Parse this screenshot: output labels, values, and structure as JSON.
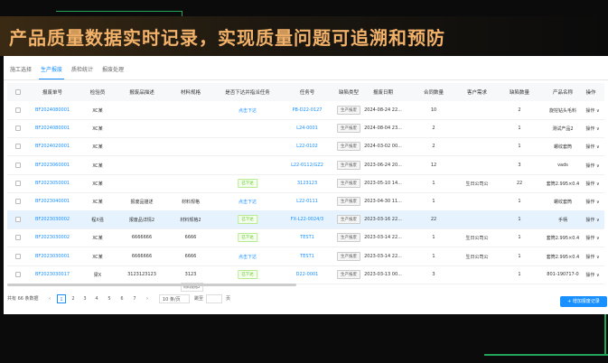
{
  "headline": "产品质量数据实时记录，实现质量问题可追溯和预防",
  "tabs": [
    "施工选择",
    "生产报废",
    "质检统计",
    "报废处理"
  ],
  "columns": [
    "",
    "报废单号",
    "检验员",
    "报废品描述",
    "材料规格",
    "是否下达并指派任务",
    "任务号",
    "缺陷类型",
    "报废日期",
    "合同数量",
    "客户需求",
    "缺陷数量",
    "产品名称",
    "操作"
  ],
  "rows": [
    {
      "no": "BF2024080001",
      "inspector": "XC某",
      "desc": "",
      "spec": "",
      "task_status": "点击下达",
      "task_no": "PB-D22-0127",
      "defect": "生产报废",
      "date": "2024-08-24 22...",
      "contract_qty": "10",
      "customer": "",
      "defect_qty": "2",
      "product": "旋挖钻头毛料",
      "action": "操作"
    },
    {
      "no": "BF2024080001",
      "inspector": "XC某",
      "desc": "",
      "spec": "",
      "task_status": "",
      "task_no": "L24-0001",
      "defect": "生产报废",
      "date": "2024-08-04 23...",
      "contract_qty": "2",
      "customer": "",
      "defect_qty": "1",
      "product": "测试产品2",
      "action": "操作"
    },
    {
      "no": "BF2024020001",
      "inspector": "XC某",
      "desc": "",
      "spec": "",
      "task_status": "",
      "task_no": "L22-0102",
      "defect": "生产报废",
      "date": "2024-03-02 00...",
      "contract_qty": "2",
      "customer": "",
      "defect_qty": "1",
      "product": "螺纹套筒",
      "action": "操作"
    },
    {
      "no": "BF2023060001",
      "inspector": "XC某",
      "desc": "",
      "spec": "",
      "task_status": "",
      "task_no": "L22-0112/GZ2",
      "defect": "生产报废",
      "date": "2023-06-24 20...",
      "contract_qty": "12",
      "customer": "",
      "defect_qty": "3",
      "product": "vads",
      "action": "操作"
    },
    {
      "no": "BF2023050001",
      "inspector": "XC某",
      "desc": "",
      "spec": "",
      "task_status": "已下达",
      "task_no": "3123123",
      "defect": "生产报废",
      "date": "2023-05-10 14...",
      "contract_qty": "1",
      "customer": "生日公司公",
      "defect_qty": "22",
      "product": "套筒2.995×0.4",
      "action": "操作"
    },
    {
      "no": "BF2023040001",
      "inspector": "XC某",
      "desc": "报废品描述",
      "spec": "材料规格",
      "task_status": "点击下达",
      "task_no": "L22-0111",
      "defect": "生产报废",
      "date": "2023-04-30 11...",
      "contract_qty": "1",
      "customer": "",
      "defect_qty": "1",
      "product": "螺纹套筒",
      "action": "操作"
    },
    {
      "no": "BF2023030002",
      "inspector": "程X强",
      "desc": "报废品详情2",
      "spec": "材料规格2",
      "task_status": "已下达",
      "task_no": "FX-L22-0024/3",
      "defect": "生产报废",
      "date": "2023-03-16 22...",
      "contract_qty": "22",
      "customer": "",
      "defect_qty": "1",
      "product": "手柄",
      "action": "操作"
    },
    {
      "no": "BF2023030002",
      "inspector": "XC某",
      "desc": "6666666",
      "spec": "6666",
      "task_status": "已下达",
      "task_no": "TEST1",
      "defect": "生产报废",
      "date": "2023-03-14 22...",
      "contract_qty": "1",
      "customer": "生日公司公",
      "defect_qty": "1",
      "product": "套筒2.995×0.4",
      "action": "操作"
    },
    {
      "no": "BF2023030001",
      "inspector": "XC某",
      "desc": "6666666",
      "spec": "6666",
      "task_status": "点击下达",
      "task_no": "TEST1",
      "defect": "生产报废",
      "date": "2023-03-14 22...",
      "contract_qty": "1",
      "customer": "生日公司公",
      "defect_qty": "1",
      "product": "套筒2.995×0.4",
      "action": "操作"
    },
    {
      "no": "BF2023030017",
      "inspector": "梁X",
      "desc": "3123123123",
      "spec": "3123",
      "task_status": "已下达",
      "task_no": "D22-0001",
      "defect": "生产报废",
      "date": "2023-03-13 00...",
      "contract_qty": "3",
      "customer": "",
      "defect_qty": "1",
      "product": "801-190717-0",
      "action": "操作"
    }
  ],
  "tooltip": "材料规格2",
  "pagination": {
    "total": "共有 66 条数据",
    "pages": [
      "1",
      "2",
      "3",
      "4",
      "5",
      "6",
      "7"
    ],
    "page_size": "10 条/页",
    "jump_label": "跳至",
    "page_suffix": "页"
  },
  "add_button": "+ 增加报废记录"
}
